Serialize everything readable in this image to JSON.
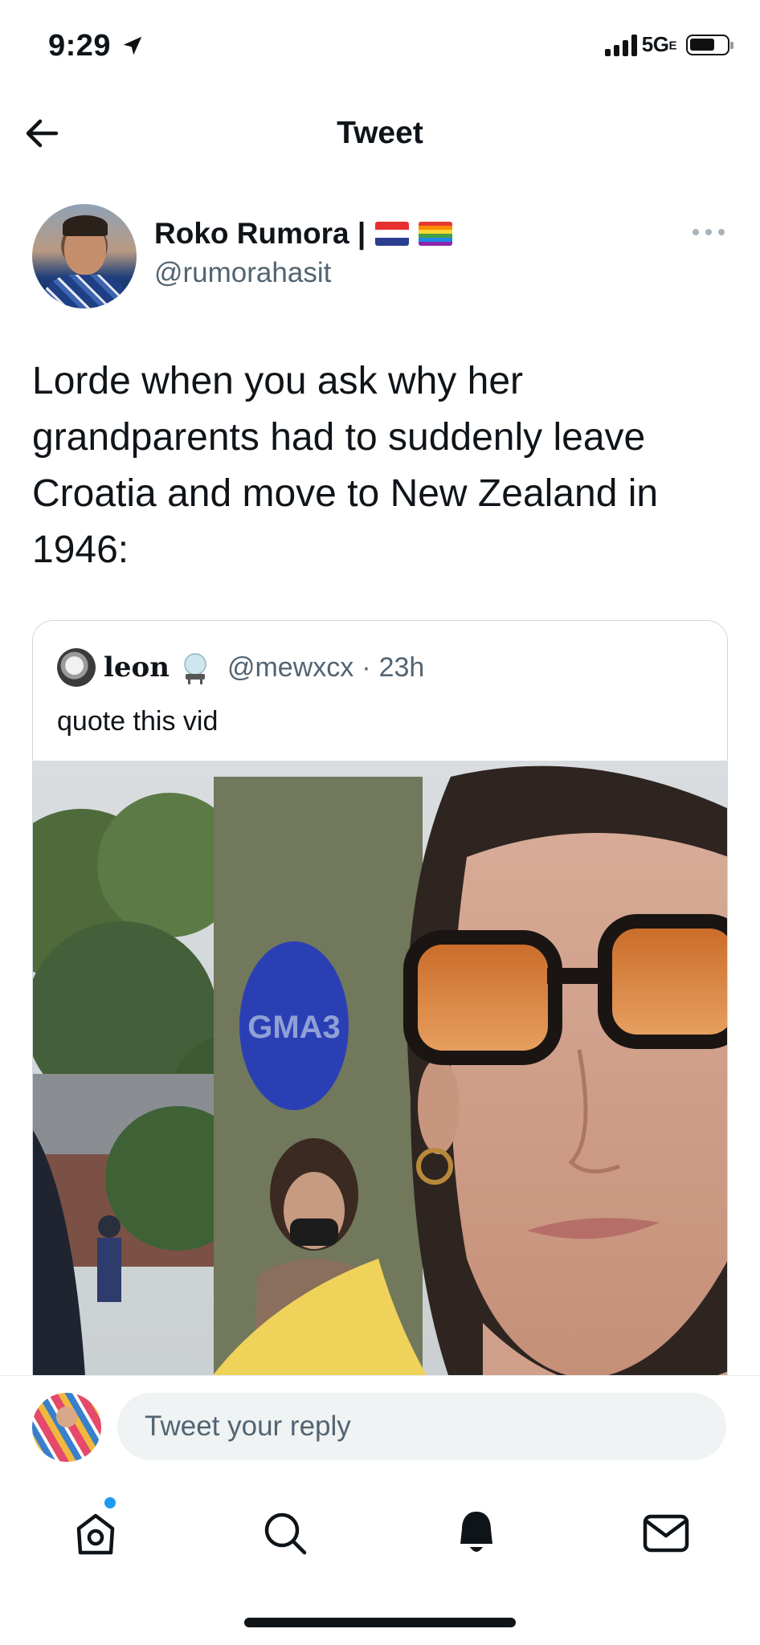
{
  "status_bar": {
    "time": "9:29",
    "network": "5G",
    "network_suffix": "E"
  },
  "header": {
    "title": "Tweet"
  },
  "tweet": {
    "author_name": "Roko Rumora |",
    "author_handle": "@rumorahasit",
    "flags": [
      "croatia-flag",
      "rainbow-flag"
    ],
    "text": "Lorde when you ask why her grandparents had to suddenly leave Croatia and move to New Zealand in 1946:"
  },
  "quoted_tweet": {
    "author_name": "leon",
    "author_handle": "@mewxcx",
    "separator": "·",
    "time": "23h",
    "text": "quote this vid",
    "media_sign_text": "GMA3"
  },
  "reply": {
    "placeholder": "Tweet your reply"
  },
  "nav": {
    "items": [
      "home-icon",
      "search-icon",
      "notifications-icon",
      "messages-icon"
    ],
    "home_badge_color": "#1d9bf0"
  },
  "colors": {
    "accent": "#1d9bf0",
    "text": "#0f1419",
    "secondary": "#536471"
  }
}
